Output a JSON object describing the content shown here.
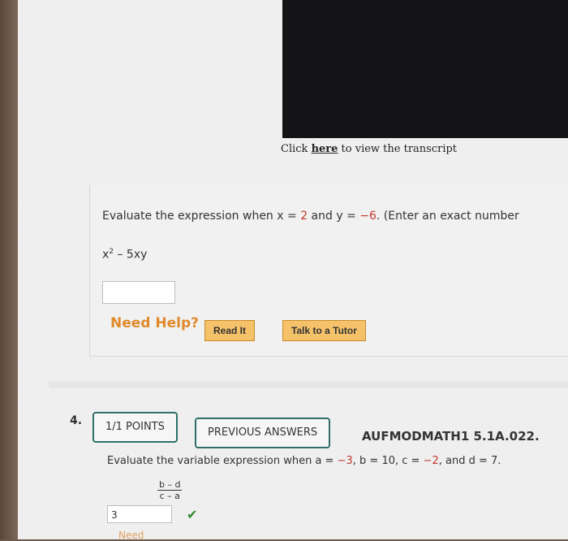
{
  "video": {
    "label": ""
  },
  "transcript": {
    "prefix": "Click ",
    "link": "here",
    "suffix": " to view the transcript"
  },
  "question3": {
    "prompt_part1": "Evaluate the expression when x = ",
    "x_value": "2",
    "prompt_part2": " and y = ",
    "y_value": "−6",
    "prompt_part3": ". (Enter an exact number",
    "expr_base": "x",
    "expr_exp": "2",
    "expr_rest": " – 5xy",
    "answer_value": ""
  },
  "help": {
    "need_help_label": "Need Help?",
    "read_it_label": "Read It",
    "talk_tutor_label": "Talk to a Tutor"
  },
  "question4": {
    "number": "4.",
    "points_label": "1/1 POINTS",
    "previous_answers_label": "PREVIOUS ANSWERS",
    "code": "AUFMODMATH1 5.1A.022.",
    "prompt": "Evaluate the variable expression when a = ",
    "a_value": "−3",
    "sep1": ", b = ",
    "b_value": "10",
    "sep2": ", c = ",
    "c_value": "−2",
    "sep3": ", and d = ",
    "d_value": "7",
    "end": ".",
    "frac_num": "b – d",
    "frac_den": "c – a",
    "answer_value": "3",
    "check_icon": "checkmark-icon",
    "partial_text": "Need"
  },
  "colors": {
    "accent": "#2f6f6a",
    "value_red": "#c0392b",
    "help_orange": "#e08a2c",
    "button_orange": "#f5c26a"
  }
}
